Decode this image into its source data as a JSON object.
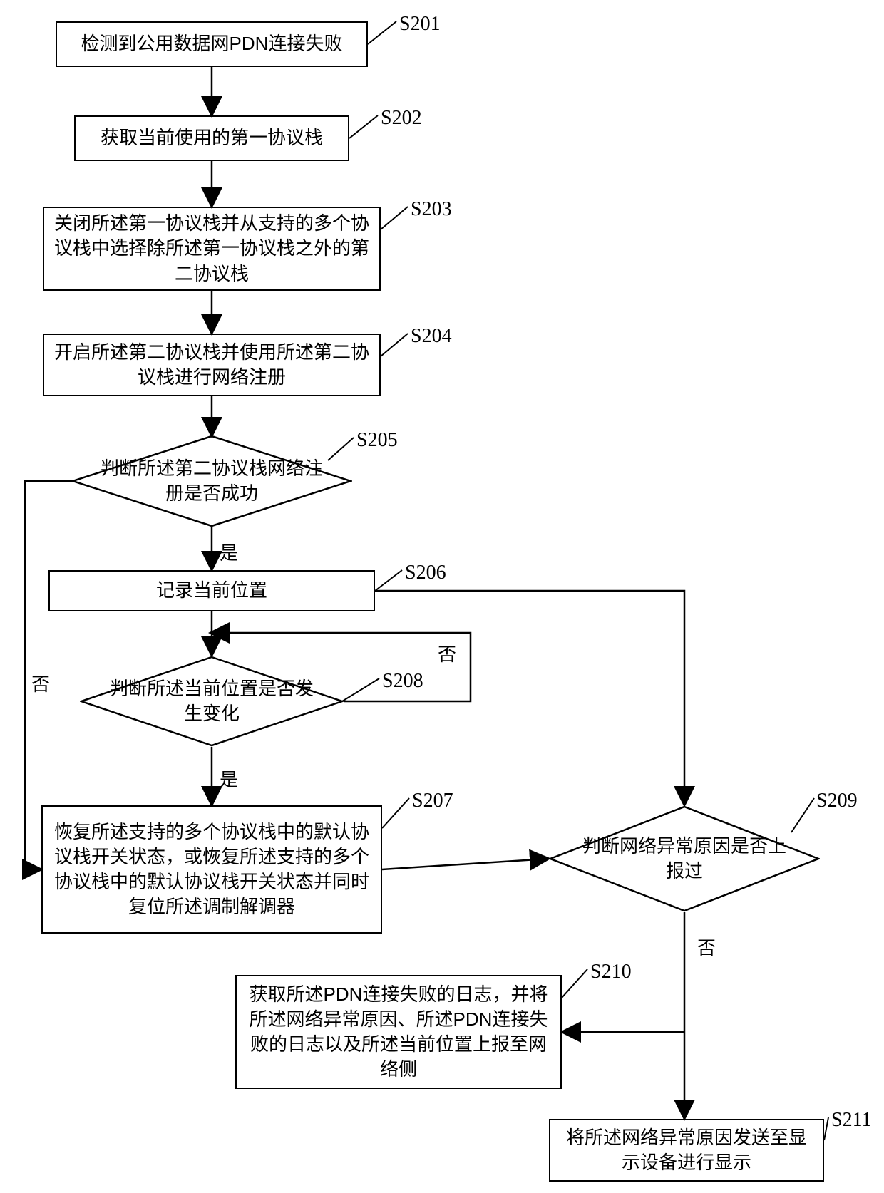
{
  "labels": {
    "s201": "S201",
    "s202": "S202",
    "s203": "S203",
    "s204": "S204",
    "s205": "S205",
    "s206": "S206",
    "s207": "S207",
    "s208": "S208",
    "s209": "S209",
    "s210": "S210",
    "s211": "S211"
  },
  "nodes": {
    "n201": "检测到公用数据网PDN连接失败",
    "n202": "获取当前使用的第一协议栈",
    "n203": "关闭所述第一协议栈并从支持的多个协议栈中选择除所述第一协议栈之外的第二协议栈",
    "n204": "开启所述第二协议栈并使用所述第二协议栈进行网络注册",
    "n205": "判断所述第二协议栈网络注册是否成功",
    "n206": "记录当前位置",
    "n207": "恢复所述支持的多个协议栈中的默认协议栈开关状态，或恢复所述支持的多个协议栈中的默认协议栈开关状态并同时复位所述调制解调器",
    "n208": "判断所述当前位置是否发生变化",
    "n209": "判断网络异常原因是否上报过",
    "n210": "获取所述PDN连接失败的日志，并将所述网络异常原因、所述PDN连接失败的日志以及所述当前位置上报至网络侧",
    "n211": "将所述网络异常原因发送至显示设备进行显示"
  },
  "edges": {
    "yes": "是",
    "no": "否"
  },
  "chart_data": {
    "type": "flowchart",
    "nodes": [
      {
        "id": "S201",
        "shape": "rect",
        "text": "检测到公用数据网PDN连接失败"
      },
      {
        "id": "S202",
        "shape": "rect",
        "text": "获取当前使用的第一协议栈"
      },
      {
        "id": "S203",
        "shape": "rect",
        "text": "关闭所述第一协议栈并从支持的多个协议栈中选择除所述第一协议栈之外的第二协议栈"
      },
      {
        "id": "S204",
        "shape": "rect",
        "text": "开启所述第二协议栈并使用所述第二协议栈进行网络注册"
      },
      {
        "id": "S205",
        "shape": "diamond",
        "text": "判断所述第二协议栈网络注册是否成功"
      },
      {
        "id": "S206",
        "shape": "rect",
        "text": "记录当前位置"
      },
      {
        "id": "S208",
        "shape": "diamond",
        "text": "判断所述当前位置是否发生变化"
      },
      {
        "id": "S207",
        "shape": "rect",
        "text": "恢复所述支持的多个协议栈中的默认协议栈开关状态，或恢复所述支持的多个协议栈中的默认协议栈开关状态并同时复位所述调制解调器"
      },
      {
        "id": "S209",
        "shape": "diamond",
        "text": "判断网络异常原因是否上报过"
      },
      {
        "id": "S210",
        "shape": "rect",
        "text": "获取所述PDN连接失败的日志，并将所述网络异常原因、所述PDN连接失败的日志以及所述当前位置上报至网络侧"
      },
      {
        "id": "S211",
        "shape": "rect",
        "text": "将所述网络异常原因发送至显示设备进行显示"
      }
    ],
    "edges": [
      {
        "from": "S201",
        "to": "S202"
      },
      {
        "from": "S202",
        "to": "S203"
      },
      {
        "from": "S203",
        "to": "S204"
      },
      {
        "from": "S204",
        "to": "S205"
      },
      {
        "from": "S205",
        "to": "S206",
        "label": "是"
      },
      {
        "from": "S205",
        "to": "S207",
        "label": "否"
      },
      {
        "from": "S206",
        "to": "S208"
      },
      {
        "from": "S206",
        "to": "S209"
      },
      {
        "from": "S208",
        "to": "S207",
        "label": "是"
      },
      {
        "from": "S208",
        "to": "S208",
        "label": "否"
      },
      {
        "from": "S207",
        "to": "S209"
      },
      {
        "from": "S209",
        "to": "S210",
        "label": "否"
      },
      {
        "from": "S210",
        "to": "S211"
      },
      {
        "from": "S209",
        "to": "S211",
        "label": "否"
      }
    ]
  }
}
